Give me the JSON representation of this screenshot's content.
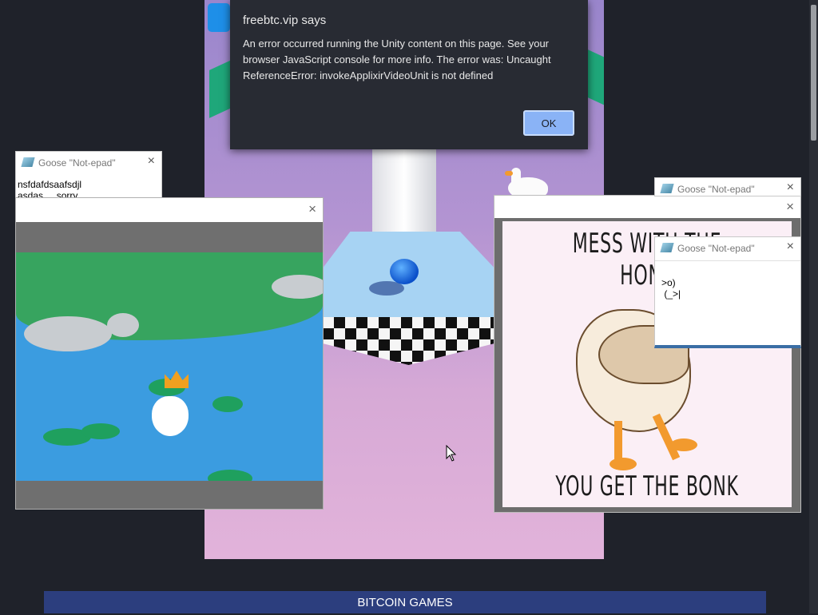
{
  "alert": {
    "title": "freebtc.vip says",
    "message": "An error occurred running the Unity content on this page. See your browser JavaScript console for more info. The error was: Uncaught ReferenceError: invokeApplixirVideoUnit is not defined",
    "ok_label": "OK"
  },
  "notepad_left": {
    "title": "Goose \"Not-epad\"",
    "text": "nsfdafdsaafsdjl\nasdas     sorry"
  },
  "notepad_right_back": {
    "title": "Goose \"Not-epad\""
  },
  "notepad_right_front": {
    "title": "Goose \"Not-epad\"",
    "text": ">o)\n (_>|"
  },
  "meme": {
    "top_text": "MESS WITH THE HONK",
    "bottom_text": "YOU GET THE BONK"
  },
  "banner": {
    "label": "BITCOIN GAMES"
  },
  "icons": {
    "close": "×"
  }
}
